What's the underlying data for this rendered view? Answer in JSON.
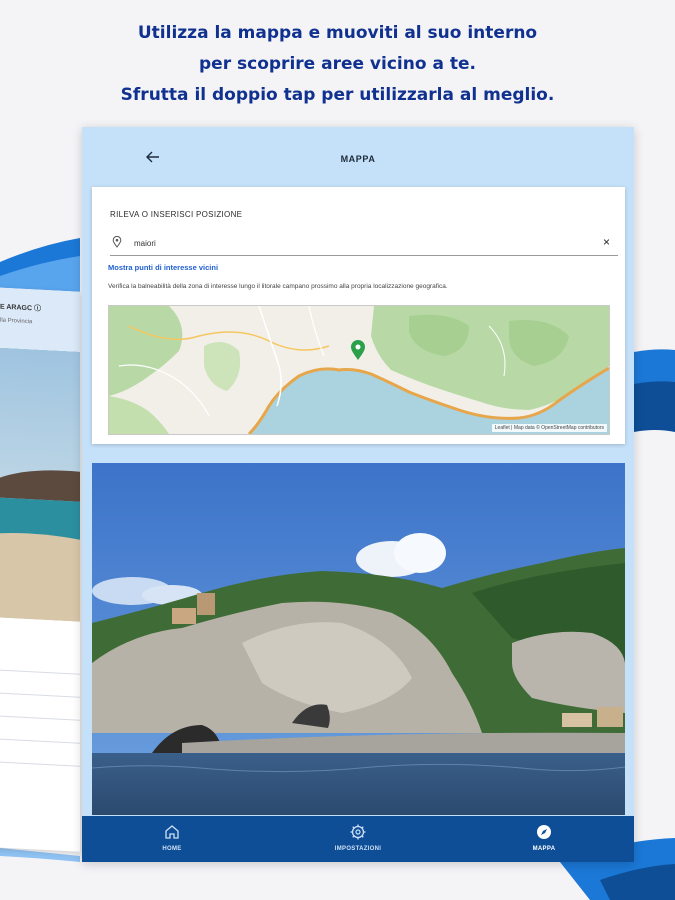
{
  "promo": {
    "line1": "Utilizza la mappa e muoviti al suo interno",
    "line2": "per scoprire aree vicino a te.",
    "line3": "Sfrutta il doppio tap per utilizzarla al meglio."
  },
  "back_screen": {
    "title": "E ARAGC ⓘ",
    "subtitle": "lla Provincia"
  },
  "header": {
    "title": "MAPPA",
    "back_icon": "arrow-left-icon"
  },
  "location_card": {
    "label": "RILEVA O INSERISCI POSIZIONE",
    "input_value": "maiori",
    "input_placeholder": "",
    "clear_icon": "×",
    "poi_link": "Mostra punti di interesse vicini",
    "description": "Verifica la balneabilità della zona di interesse lungo il litorale campano prossimo alla propria localizzazione geografica.",
    "map_attribution": "Leaflet | Map data © OpenStreetMap contributors"
  },
  "bottom_nav": {
    "items": [
      {
        "label": "HOME",
        "icon": "home-icon",
        "active": false
      },
      {
        "label": "IMPOSTAZIONI",
        "icon": "gear-icon",
        "active": false
      },
      {
        "label": "MAPPA",
        "icon": "compass-icon",
        "active": true
      }
    ]
  },
  "colors": {
    "headline": "#10318f",
    "tablet_bg": "#c5e1f9",
    "nav_bg": "#0e4e97",
    "link": "#1f5fd0",
    "map_marker": "#2aa04a"
  }
}
